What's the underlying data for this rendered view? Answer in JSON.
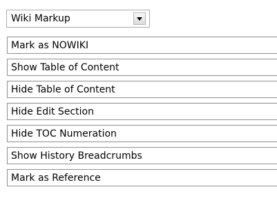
{
  "dropdown": {
    "selected": "Wiki Markup",
    "arrow_icon": "chevron-down-icon"
  },
  "menu": {
    "items": [
      {
        "label": "Mark as NOWIKI"
      },
      {
        "label": "Show Table of Content"
      },
      {
        "label": "Hide Table of Content"
      },
      {
        "label": "Hide Edit Section"
      },
      {
        "label": "Hide TOC Numeration"
      },
      {
        "label": "Show History Breadcrumbs"
      },
      {
        "label": "Mark as Reference"
      }
    ]
  }
}
